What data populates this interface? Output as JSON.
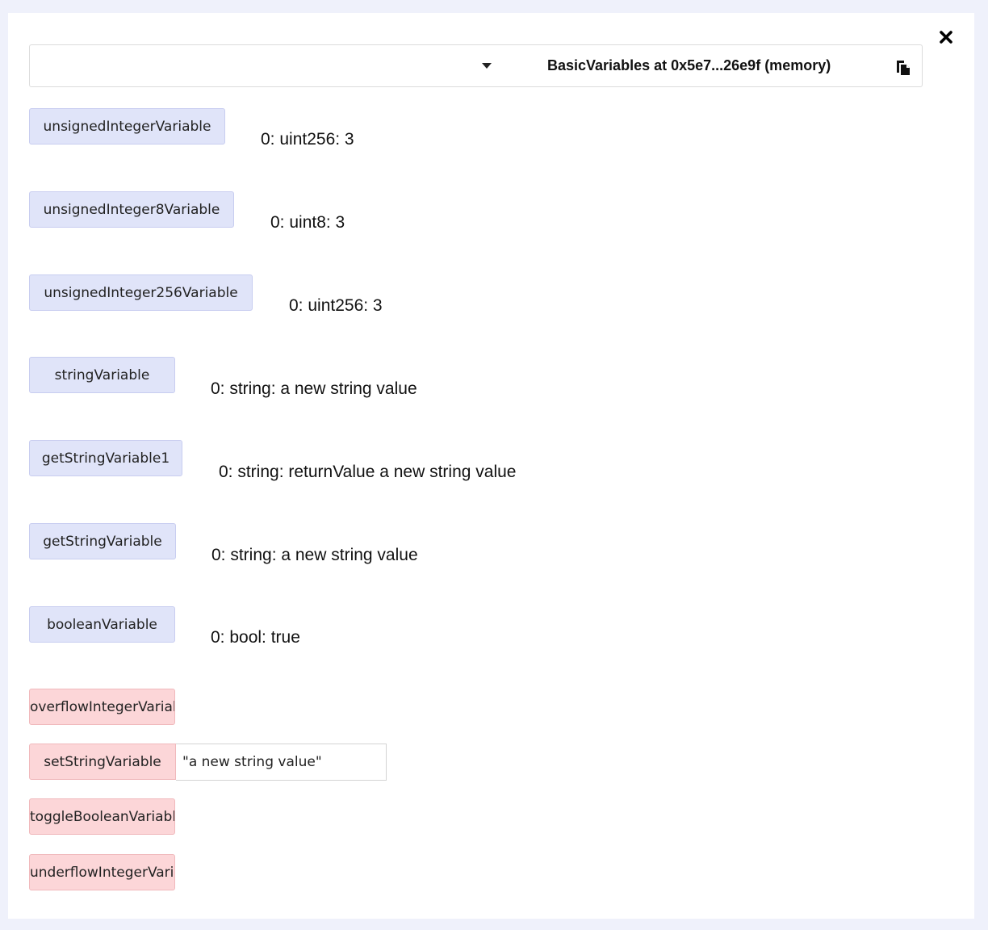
{
  "header": {
    "contract_title": "BasicVariables at 0x5e7...26e9f (memory)"
  },
  "functions": {
    "unsignedIntegerVariable": {
      "label": "unsignedIntegerVariable",
      "result": "0: uint256: 3"
    },
    "unsignedInteger8Variable": {
      "label": "unsignedInteger8Variable",
      "result": "0: uint8: 3"
    },
    "unsignedInteger256Variable": {
      "label": "unsignedInteger256Variable",
      "result": "0: uint256: 3"
    },
    "stringVariable": {
      "label": "stringVariable",
      "result": "0: string: a new string value"
    },
    "getStringVariable1": {
      "label": "getStringVariable1",
      "result": "0: string: returnValue a new string value"
    },
    "getStringVariable": {
      "label": "getStringVariable",
      "result": "0: string: a new string value"
    },
    "booleanVariable": {
      "label": "booleanVariable",
      "result": "0: bool: true"
    }
  },
  "transactions": {
    "overflow": {
      "label": "overflowIntegerVariable"
    },
    "setString": {
      "label": "setStringVariable",
      "input_value": "\"a new string value\""
    },
    "toggle": {
      "label": "toggleBooleanVariable"
    },
    "underflow": {
      "label": "underflowIntegerVariable"
    }
  },
  "icons": {
    "close": "close-icon",
    "caret": "caret-down-icon",
    "copy": "clipboard-copy-icon"
  },
  "colors": {
    "call_button": "#e0e4f9",
    "transact_button": "#fcd6d8",
    "page_background": "#eff1fb"
  }
}
